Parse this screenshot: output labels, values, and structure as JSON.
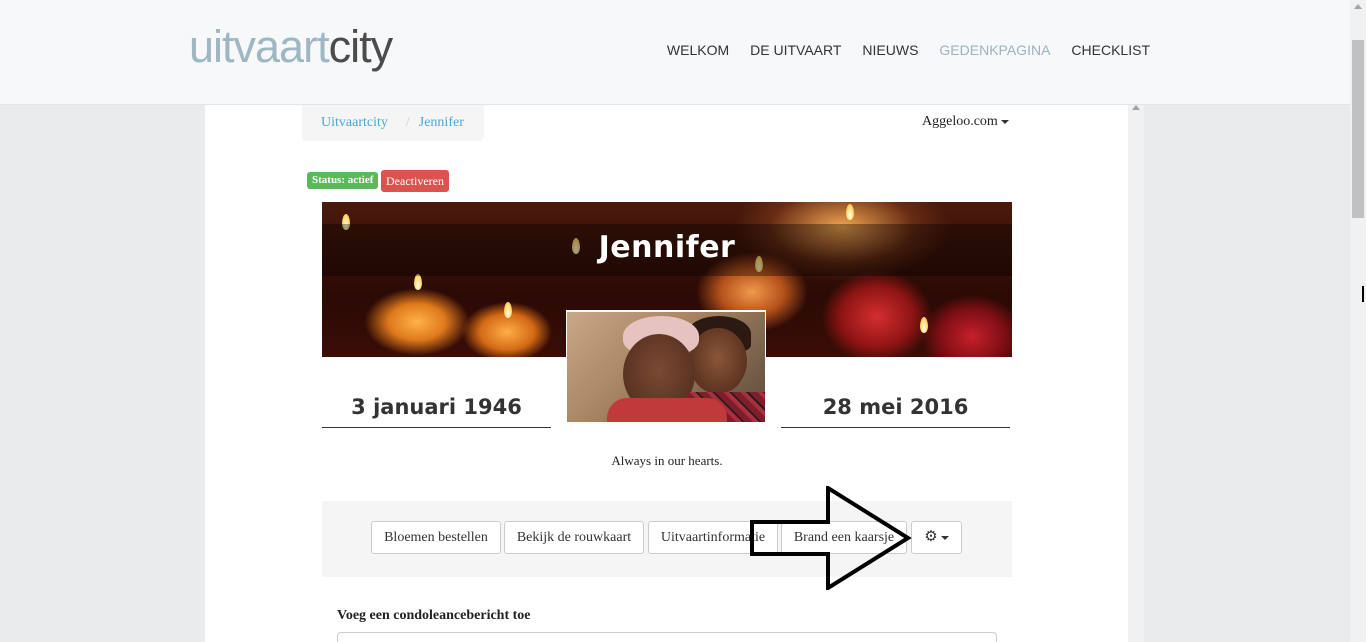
{
  "header": {
    "logo_part1": "uitvaart",
    "logo_part2": "city",
    "nav": [
      "WELKOM",
      "DE UITVAART",
      "NIEUWS",
      "GEDENKPAGINA",
      "CHECKLIST"
    ],
    "active_nav": "GEDENKPAGINA"
  },
  "breadcrumb": {
    "home": "Uitvaartcity",
    "sep": "/",
    "current": "Jennifer"
  },
  "site_dropdown": {
    "label": "Aggeloo.com"
  },
  "status": {
    "badge": "Status: actief",
    "deactivate": "Deactiveren"
  },
  "memorial": {
    "name": "Jennifer",
    "birth_date": "3 januari 1946",
    "death_date": "28 mei 2016",
    "epitaph": "Always in our hearts."
  },
  "actions": {
    "flowers": "Bloemen bestellen",
    "card": "Bekijk de rouwkaart",
    "info": "Uitvaartinformatie",
    "candle": "Brand een kaarsje",
    "settings_icon": "gear-icon"
  },
  "condolence": {
    "label": "Voeg een condoleancebericht toe"
  },
  "colors": {
    "status_green": "#5cb85c",
    "danger_red": "#d9534f",
    "link_blue": "#4ea6d6",
    "nav_active": "#9cb3bf"
  }
}
